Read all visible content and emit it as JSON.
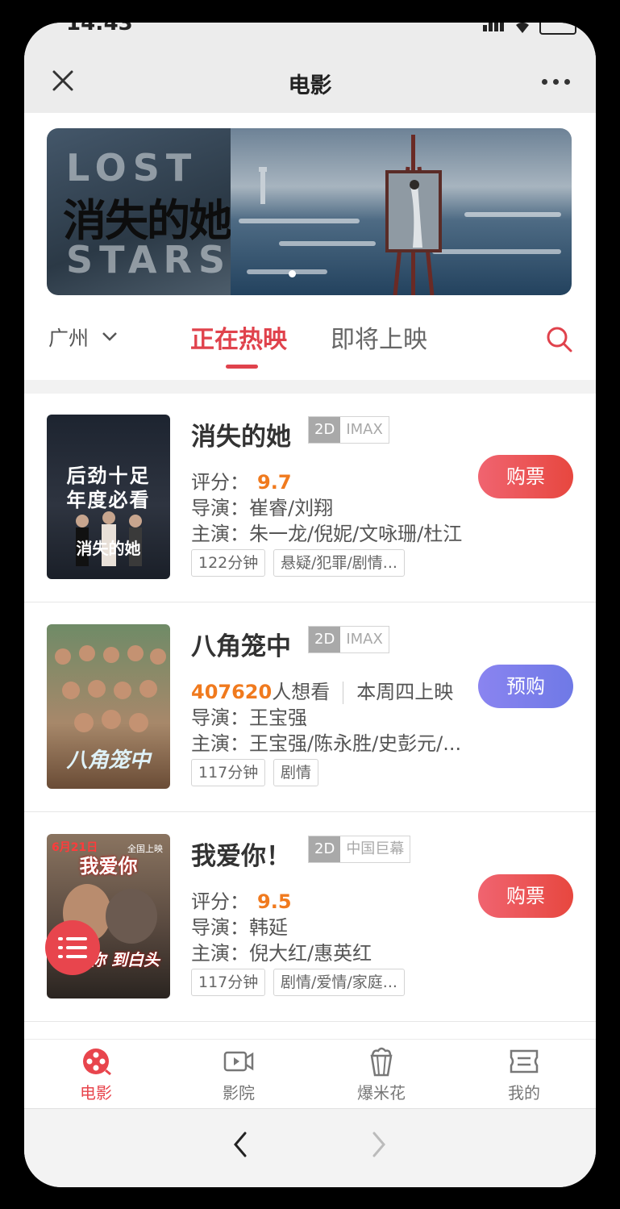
{
  "status": {
    "time": "14:43"
  },
  "nav": {
    "title": "电影"
  },
  "banner": {
    "word_top": "LOST",
    "title_cn": "消失的她",
    "word_bottom": "STARS"
  },
  "filter": {
    "city": "广州",
    "tab_now": "正在热映",
    "tab_soon": "即将上映"
  },
  "movies": [
    {
      "title": "消失的她",
      "fmt_a": "2D",
      "fmt_b": "IMAX",
      "score_label": "评分：",
      "score": "9.7",
      "director": "导演：崔睿/刘翔",
      "cast": "主演：朱一龙/倪妮/文咏珊/杜江",
      "chip1": "122分钟",
      "chip2": "悬疑/犯罪/剧情...",
      "button": "购票",
      "poster_line1": "后劲十足",
      "poster_line2": "年度必看",
      "poster_title": "消失的她"
    },
    {
      "title": "八角笼中",
      "fmt_a": "2D",
      "fmt_b": "IMAX",
      "want_count": "407620",
      "want_label": "人想看",
      "release": "本周四上映",
      "director": "导演：王宝强",
      "cast": "主演：王宝强/陈永胜/史彭元/...",
      "chip1": "117分钟",
      "chip2": "剧情",
      "button": "预购",
      "poster_title": "八角笼中"
    },
    {
      "title": "我爱你！",
      "fmt_a": "2D",
      "fmt_b": "中国巨幕",
      "score_label": "评分：",
      "score": "9.5",
      "director": "导演：韩延",
      "cast": "主演：倪大红/惠英红",
      "chip1": "117分钟",
      "chip2": "剧情/爱情/家庭...",
      "button": "购票",
      "poster_title": "我爱你",
      "poster_date": "6月21日",
      "poster_tag": "全国上映",
      "poster_line": "很爱你 到白头"
    }
  ],
  "tabbar": {
    "t1": "电影",
    "t2": "影院",
    "t3": "爆米花",
    "t4": "我的"
  },
  "colors": {
    "accent": "#e0424c",
    "score": "#f07a1e",
    "preorder": "#7a7eec"
  }
}
